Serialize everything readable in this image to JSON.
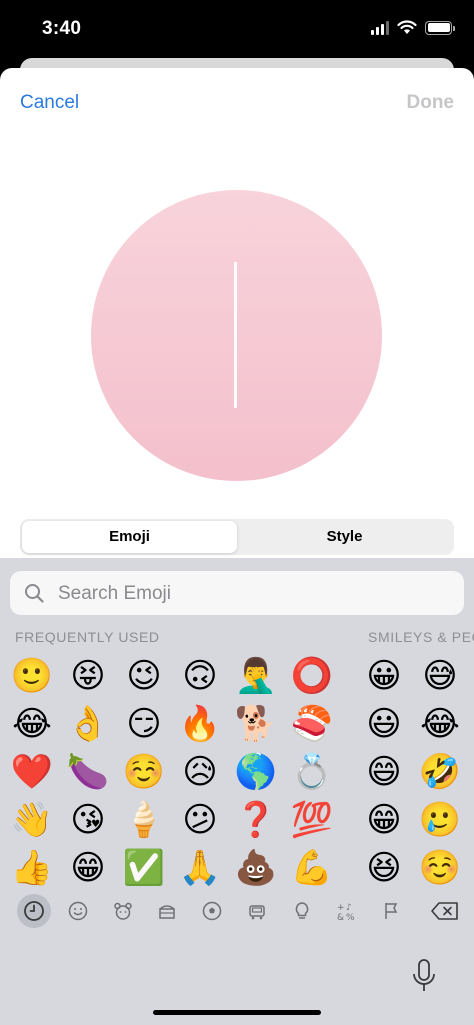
{
  "status": {
    "time": "3:40"
  },
  "nav": {
    "cancel": "Cancel",
    "done": "Done"
  },
  "segments": [
    "Emoji",
    "Style"
  ],
  "search": {
    "placeholder": "Search Emoji"
  },
  "sections": {
    "frequent": "FREQUENTLY USED",
    "smileys": "SMILEYS & PEO"
  },
  "emojis": {
    "frequent": [
      [
        "🙂",
        "😝",
        "😉",
        "🙃",
        "🤦‍♂️",
        "⭕"
      ],
      [
        "😂",
        "👌",
        "😏",
        "🔥",
        "🐕",
        "🍣"
      ],
      [
        "❤️",
        "🍆",
        "☺️",
        "😥",
        "🌎",
        "💍"
      ],
      [
        "👋",
        "😘",
        "🍦",
        "😕",
        "❓",
        "💯"
      ],
      [
        "👍",
        "😁",
        "✅",
        "🙏",
        "💩",
        "💪"
      ]
    ],
    "smileys": [
      [
        "😀",
        "😅"
      ],
      [
        "😃",
        "😂"
      ],
      [
        "😄",
        "🤣"
      ],
      [
        "😁",
        "🥲"
      ],
      [
        "😆",
        "☺️"
      ]
    ]
  },
  "categories": [
    "clock-icon",
    "smiley-icon",
    "animal-icon",
    "food-icon",
    "sports-icon",
    "travel-icon",
    "objects-icon",
    "symbols-icon",
    "flag-icon",
    "delete-icon"
  ],
  "colors": {
    "accent": "#2a7ae2",
    "avatar_bg": "#f6cad4",
    "keyboard_bg": "#d6d8de"
  }
}
